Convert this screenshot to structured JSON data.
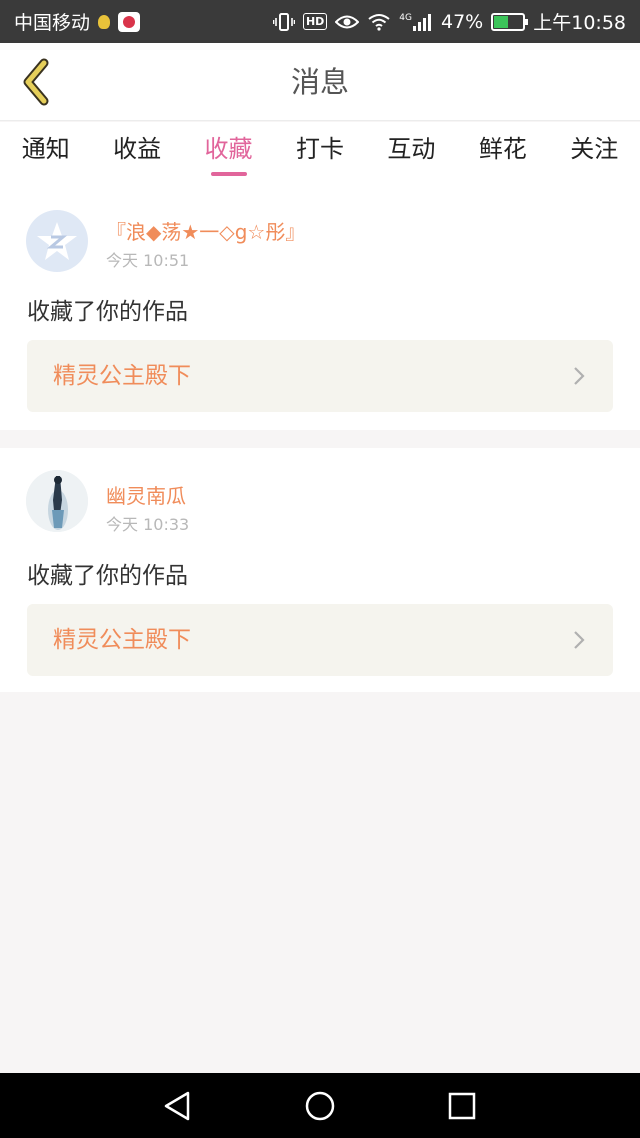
{
  "status_bar": {
    "carrier": "中国移动",
    "network": "4G",
    "battery": "47%",
    "time": "上午10:58",
    "hd_badge": "HD",
    "icons": [
      "bulb-icon",
      "app-badge-icon",
      "vibrate-icon",
      "hd-icon",
      "eye-icon",
      "wifi-icon",
      "signal-icon",
      "battery-icon"
    ]
  },
  "header": {
    "title": "消息",
    "back_icon": "chevron-left-icon"
  },
  "tabs": [
    {
      "label": "通知",
      "active": false
    },
    {
      "label": "收益",
      "active": false
    },
    {
      "label": "收藏",
      "active": true
    },
    {
      "label": "打卡",
      "active": false
    },
    {
      "label": "互动",
      "active": false
    },
    {
      "label": "鲜花",
      "active": false
    },
    {
      "label": "关注",
      "active": false
    }
  ],
  "notifications": [
    {
      "username": "『浪◆荡★一◇g☆彤』",
      "time": "今天 10:51",
      "message": "收藏了你的作品",
      "work_title": "精灵公主殿下"
    },
    {
      "username": "幽灵南瓜",
      "time": "今天 10:33",
      "message": "收藏了你的作品",
      "work_title": "精灵公主殿下"
    }
  ],
  "colors": {
    "accent": "#e1659b",
    "username": "#f08c5a",
    "work_bg": "#f5f4ee",
    "back_arrow": "#d4b948"
  }
}
